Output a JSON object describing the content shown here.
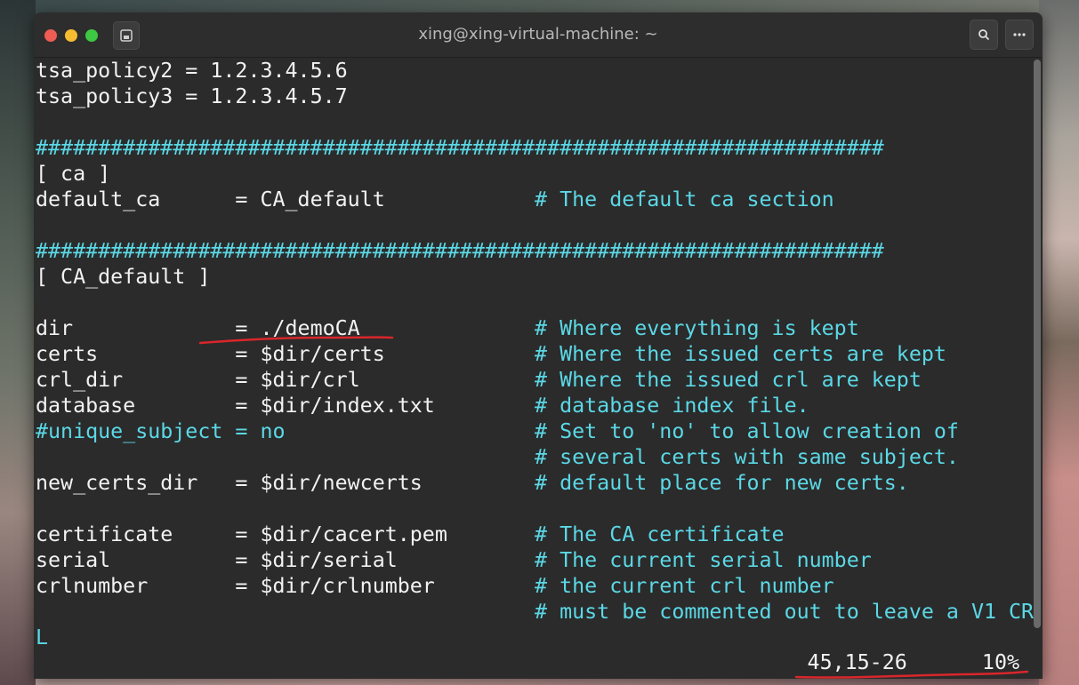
{
  "window": {
    "title": "xing@xing-virtual-machine: ~"
  },
  "terminal": {
    "lines": [
      {
        "parts": [
          {
            "t": "tsa_policy2 = 1.2.3.4.5.6",
            "c": "w"
          }
        ]
      },
      {
        "parts": [
          {
            "t": "tsa_policy3 = 1.2.3.4.5.7",
            "c": "w"
          }
        ]
      },
      {
        "parts": []
      },
      {
        "parts": [
          {
            "t": "####################################################################",
            "c": "c"
          }
        ]
      },
      {
        "parts": [
          {
            "t": "[ ca ]",
            "c": "w"
          }
        ]
      },
      {
        "parts": [
          {
            "t": "default_ca      = CA_default            ",
            "c": "w"
          },
          {
            "t": "# The default ca section",
            "c": "c"
          }
        ]
      },
      {
        "parts": []
      },
      {
        "parts": [
          {
            "t": "####################################################################",
            "c": "c"
          }
        ]
      },
      {
        "parts": [
          {
            "t": "[ CA_default ]",
            "c": "w"
          }
        ]
      },
      {
        "parts": []
      },
      {
        "parts": [
          {
            "t": "dir             = ./demoCA              ",
            "c": "w"
          },
          {
            "t": "# Where everything is kept",
            "c": "c"
          }
        ]
      },
      {
        "parts": [
          {
            "t": "certs           = $dir/certs            ",
            "c": "w"
          },
          {
            "t": "# Where the issued certs are kept",
            "c": "c"
          }
        ]
      },
      {
        "parts": [
          {
            "t": "crl_dir         = $dir/crl              ",
            "c": "w"
          },
          {
            "t": "# Where the issued crl are kept",
            "c": "c"
          }
        ]
      },
      {
        "parts": [
          {
            "t": "database        = $dir/index.txt        ",
            "c": "w"
          },
          {
            "t": "# database index file.",
            "c": "c"
          }
        ]
      },
      {
        "parts": [
          {
            "t": "#unique_subject = no                    ",
            "c": "c"
          },
          {
            "t": "# Set to 'no' to allow creation of",
            "c": "c"
          }
        ]
      },
      {
        "parts": [
          {
            "t": "                                        ",
            "c": "w"
          },
          {
            "t": "# several certs with same subject.",
            "c": "c"
          }
        ]
      },
      {
        "parts": [
          {
            "t": "new_certs_dir   = $dir/newcerts         ",
            "c": "w"
          },
          {
            "t": "# default place for new certs.",
            "c": "c"
          }
        ]
      },
      {
        "parts": []
      },
      {
        "parts": [
          {
            "t": "certificate     = $dir/cacert.pem       ",
            "c": "w"
          },
          {
            "t": "# The CA certificate",
            "c": "c"
          }
        ]
      },
      {
        "parts": [
          {
            "t": "serial          = $dir/serial           ",
            "c": "w"
          },
          {
            "t": "# The current serial number",
            "c": "c"
          }
        ]
      },
      {
        "parts": [
          {
            "t": "crlnumber       = $dir/crlnumber        ",
            "c": "w"
          },
          {
            "t": "# the current crl number",
            "c": "c"
          }
        ]
      },
      {
        "parts": [
          {
            "t": "                                        ",
            "c": "w"
          },
          {
            "t": "# must be commented out to leave a V1 CR",
            "c": "c"
          }
        ]
      },
      {
        "parts": [
          {
            "t": "L",
            "c": "c"
          }
        ]
      }
    ],
    "status": {
      "position": "45,15-26",
      "percent": "10%"
    }
  },
  "annotations": {
    "underline_color": "#d9262b"
  }
}
